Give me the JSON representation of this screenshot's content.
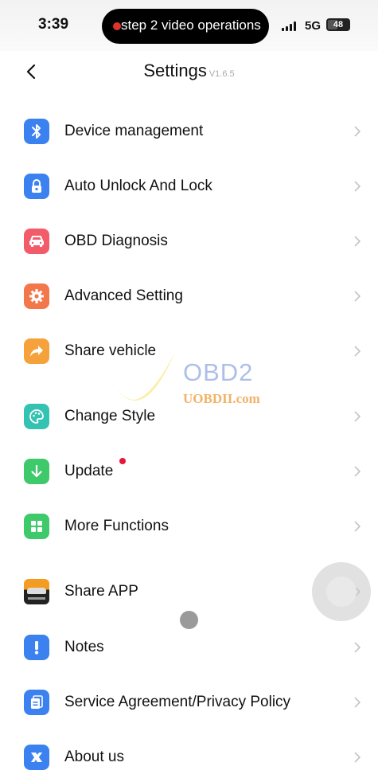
{
  "status_bar": {
    "time": "3:39",
    "recording_label": "step 2 video operations",
    "network": "5G",
    "battery": "48",
    "battery_fraction": 0.48
  },
  "header": {
    "title": "Settings",
    "version": "V1.6.5"
  },
  "menu": {
    "items": [
      {
        "label": "Device management",
        "icon": "bluetooth-icon",
        "color": "#3b82f0"
      },
      {
        "label": "Auto Unlock And Lock",
        "icon": "lock-icon",
        "color": "#3b82f0"
      },
      {
        "label": "OBD Diagnosis",
        "icon": "car-icon",
        "color": "#f25b6a"
      },
      {
        "label": "Advanced Setting",
        "icon": "gear-icon",
        "color": "#f2784b"
      },
      {
        "label": "Share vehicle",
        "icon": "share-arrow-icon",
        "color": "#f6a23c"
      },
      {
        "label": "Change Style",
        "icon": "palette-icon",
        "color": "#34c2b3"
      },
      {
        "label": "Update",
        "icon": "download-arrow-icon",
        "color": "#3ec96b"
      },
      {
        "label": "More Functions",
        "icon": "grid-icon",
        "color": "#3ec96b"
      },
      {
        "label": "Share APP",
        "icon": "app-thumbnail-icon",
        "color": "#f39c21"
      },
      {
        "label": "Notes",
        "icon": "exclamation-icon",
        "color": "#3b82f0"
      },
      {
        "label": "Service Agreement/Privacy Policy",
        "icon": "document-icon",
        "color": "#3b82f0"
      },
      {
        "label": "About us",
        "icon": "about-icon",
        "color": "#3b82f0"
      }
    ]
  },
  "watermark": {
    "brand": "OBD2",
    "site": "UOBDII.com"
  }
}
